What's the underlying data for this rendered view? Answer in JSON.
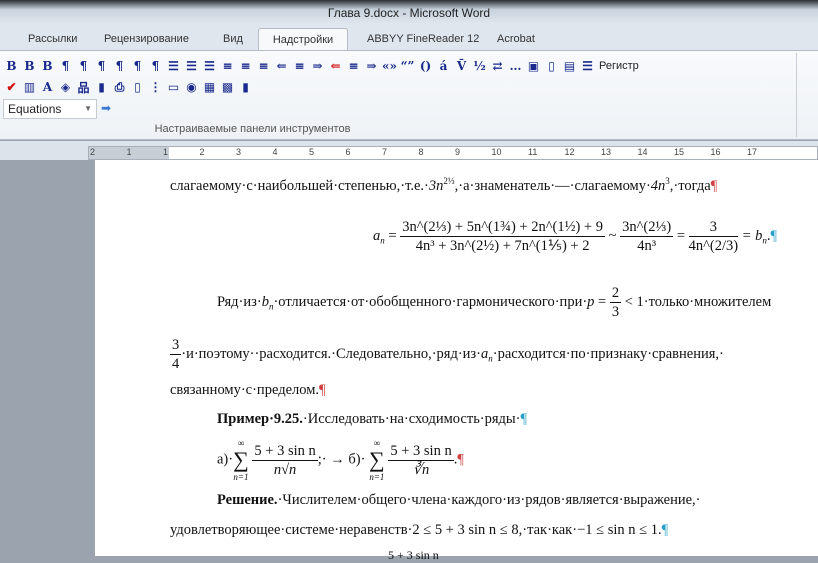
{
  "window": {
    "title": "Глава 9.docx  -  Microsoft Word"
  },
  "tabs": [
    {
      "label": "Рассылки"
    },
    {
      "label": "Рецензирование"
    },
    {
      "label": "Вид"
    },
    {
      "label": "Надстройки",
      "active": true
    },
    {
      "label": "ABBYY FineReader 12"
    },
    {
      "label": "Acrobat"
    }
  ],
  "toolbar": {
    "row1": [
      {
        "name": "bold-icon",
        "g": "B"
      },
      {
        "name": "bold-alt-icon",
        "g": "B"
      },
      {
        "name": "bold-heavy-icon",
        "g": "B"
      },
      {
        "name": "para-top-icon",
        "g": "¶"
      },
      {
        "name": "para-top2-icon",
        "g": "¶"
      },
      {
        "name": "para-top3-icon",
        "g": "¶"
      },
      {
        "name": "para-bottom-icon",
        "g": "¶"
      },
      {
        "name": "para-bottom2-icon",
        "g": "¶"
      },
      {
        "name": "para-bottom3-icon",
        "g": "¶"
      },
      {
        "name": "para-box-icon",
        "g": "☰"
      },
      {
        "name": "para-box2-icon",
        "g": "☰"
      },
      {
        "name": "para-box3-icon",
        "g": "☰"
      },
      {
        "name": "lines-icon",
        "g": "≡"
      },
      {
        "name": "lines2-icon",
        "g": "≡"
      },
      {
        "name": "lines3-icon",
        "g": "≡"
      },
      {
        "name": "indent-left-icon",
        "g": "⇐"
      },
      {
        "name": "lines4-icon",
        "g": "≡"
      },
      {
        "name": "indent-right-icon",
        "g": "⇒"
      },
      {
        "name": "red-indent-icon",
        "g": "⇐",
        "red": true
      },
      {
        "name": "lines5-icon",
        "g": "≡"
      },
      {
        "name": "indent-right2-icon",
        "g": "⇒"
      },
      {
        "name": "guillemets-icon",
        "g": "«»"
      },
      {
        "name": "quotes-icon",
        "g": "“”"
      },
      {
        "name": "parentheses-icon",
        "g": "()"
      },
      {
        "name": "accent-icon",
        "g": "á"
      },
      {
        "name": "overline-icon",
        "g": "V̄"
      },
      {
        "name": "fraction-icon",
        "g": "½"
      },
      {
        "name": "swap-arrow-icon",
        "g": "⇄"
      },
      {
        "name": "ellipsis-icon",
        "g": "…"
      },
      {
        "name": "window-icon",
        "g": "▣"
      },
      {
        "name": "small-box-icon",
        "g": "▯"
      },
      {
        "name": "page-icon",
        "g": "▤"
      },
      {
        "name": "list-icon",
        "g": "☰"
      }
    ],
    "register_label": "Регистр",
    "row2": [
      {
        "name": "spellcheck-icon",
        "g": "✔",
        "red": true
      },
      {
        "name": "columns-icon",
        "g": "▥"
      },
      {
        "name": "font-a-icon",
        "g": "A"
      },
      {
        "name": "cube-icon",
        "g": "◈"
      },
      {
        "name": "org-chart-icon",
        "g": "品"
      },
      {
        "name": "bar-chart-icon",
        "g": "▮"
      },
      {
        "name": "printer-icon",
        "g": "⎙"
      },
      {
        "name": "document-icon",
        "g": "▯"
      },
      {
        "name": "bullets-icon",
        "g": "⋮"
      },
      {
        "name": "folder-icon",
        "g": "▭"
      },
      {
        "name": "globe-doc-icon",
        "g": "◉"
      },
      {
        "name": "table-grid-icon",
        "g": "▦"
      },
      {
        "name": "calculator-icon",
        "g": "▩"
      },
      {
        "name": "jar-icon",
        "g": "▮"
      }
    ],
    "style_combo": "Equations",
    "group_label": "Настраиваемые панели инструментов"
  },
  "ruler": {
    "ticks": [
      "2",
      "1",
      "1",
      "2",
      "3",
      "4",
      "5",
      "6",
      "7",
      "8",
      "9",
      "10",
      "11",
      "12",
      "13",
      "14",
      "15",
      "16",
      "17"
    ]
  },
  "document": {
    "l1a": "слагаемому·с·наибольшей·степенью,·т.е.·",
    "l1b": "3n",
    "l1c": "2⅓",
    "l1d": ",·а·знаменатель·—·слагаемому·",
    "l1e": "4n",
    "l1f": "3",
    "l1g": ",·тогда",
    "f_an": "a",
    "f_n": "n",
    "f_num": "3n^(2⅓) + 5n^(1¾) + 2n^(1½) + 9",
    "f_den": "4n³ + 3n^(2½) + 7n^(1⅕) + 2",
    "f_eq": " = ",
    "f_tilde": " ~ ",
    "f_num2": "3n^(2⅓)",
    "f_den2": "4n³",
    "f_eq2": " = ",
    "f_num3": "3",
    "f_den3": "4n^(2/3)",
    "f_tail": " = b",
    "f_tail2": "n",
    "l2a": "Ряд·из·",
    "l2b": "b",
    "l2c": "n",
    "l2d": "·отличается·от·обобщенного·гармонического·при·",
    "l2e": "p",
    "l2f": " = ",
    "l2g": "2",
    "l2h": "3",
    "l2i": " < 1·только·множителем",
    "l3a": "3",
    "l3b": "4",
    "l3c": "·и·поэтому··расходится.·Следовательно,·ряд·из·",
    "l3d": "a",
    "l3e": "n",
    "l3f": "·расходится·по·признаку·сравнения,·",
    "l4": "связанному·с·пределом.",
    "l5a": "Пример·9.25.",
    "l5b": "·Исследовать·на·сходимость·ряды·",
    "l6a": "а)·",
    "sum_top": "∞",
    "sum_sym": "∑",
    "sum_bot": "n=1",
    "l6num": "5 + 3 sin n",
    "l6den": "n√n",
    "l6b": ";·  →  ",
    "l6c": "б)·",
    "l6den2": "∛n",
    "l6d": ".",
    "l7a": "Решение.",
    "l7b": "·Числителем·общего·члена·каждого·из·рядов·является·выражение,·",
    "l8a": "удовлетворяющее·системе·неравенств·",
    "l8b": "2 ≤ 5 + 3 sin n ≤ 8",
    "l8c": ",·так·как·",
    "l8d": "−1 ≤ sin n ≤ 1",
    "l8e": ".",
    "l9": "5 + 3 sin n",
    "pilcrow": "¶"
  }
}
